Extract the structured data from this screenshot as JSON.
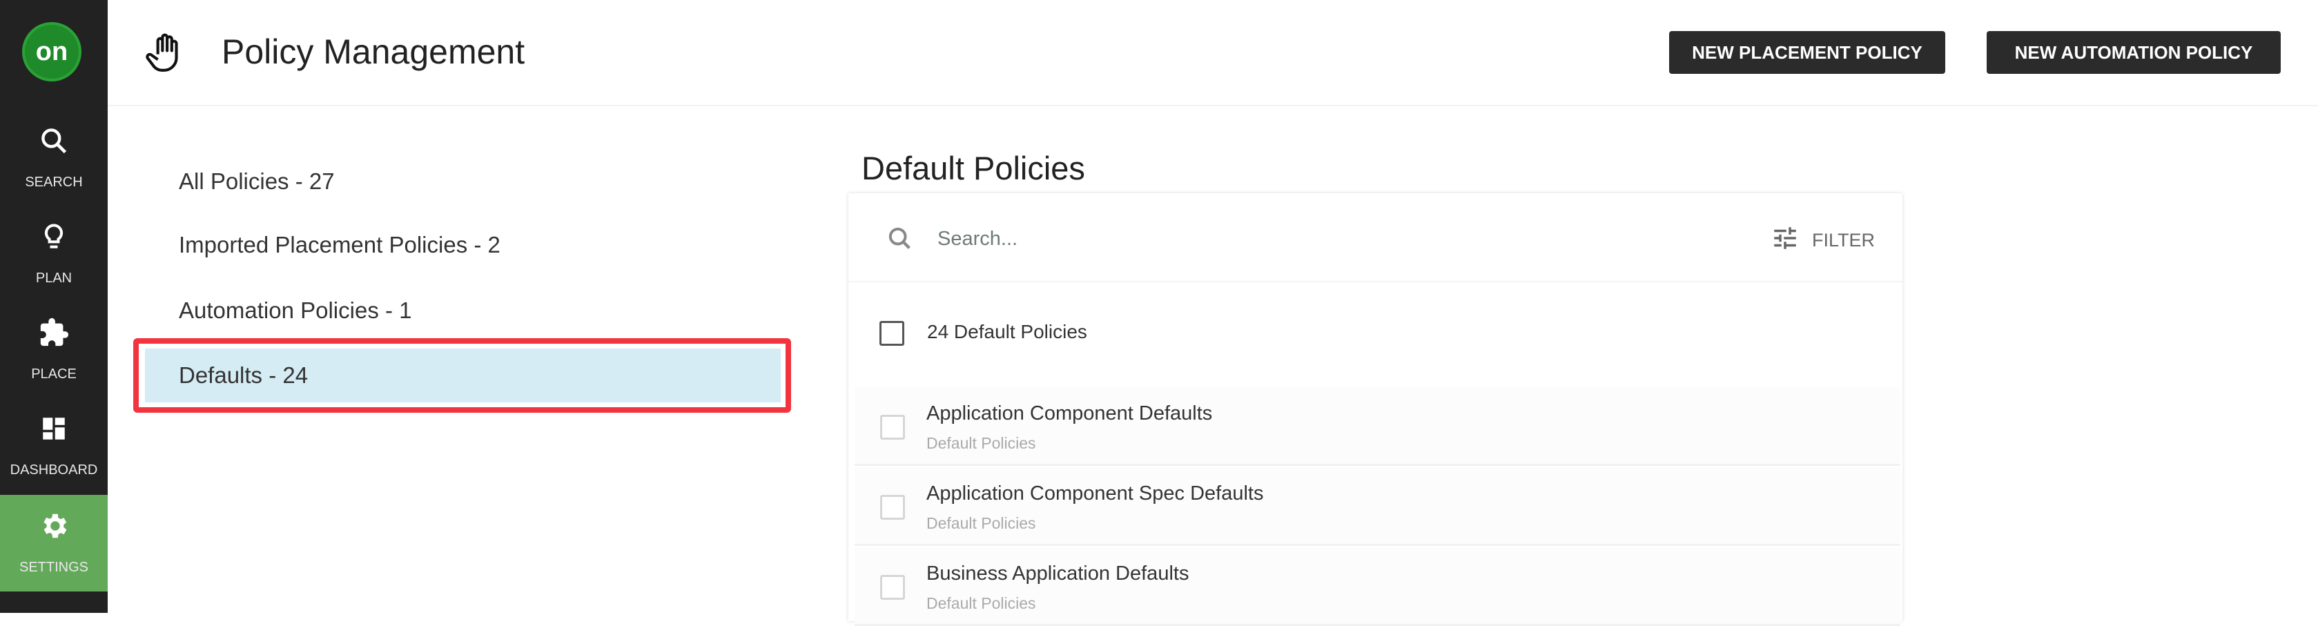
{
  "sidebar": {
    "logo": "on",
    "items": [
      {
        "label": "SEARCH",
        "icon": "search-icon"
      },
      {
        "label": "PLAN",
        "icon": "lightbulb-icon"
      },
      {
        "label": "PLACE",
        "icon": "puzzle-icon"
      },
      {
        "label": "DASHBOARD",
        "icon": "dashboard-icon"
      },
      {
        "label": "SETTINGS",
        "icon": "gear-icon",
        "active": true
      }
    ],
    "active_color": "#63a95a"
  },
  "header": {
    "title": "Policy Management",
    "icon": "hand-icon",
    "buttons": {
      "new_placement": "NEW PLACEMENT POLICY",
      "new_automation": "NEW AUTOMATION POLICY"
    }
  },
  "categories": [
    {
      "label": "All Policies - 27"
    },
    {
      "label": "Imported Placement Policies - 2"
    },
    {
      "label": "Automation Policies - 1"
    },
    {
      "label": "Defaults - 24",
      "selected": true
    }
  ],
  "main": {
    "heading": "Default Policies",
    "search_placeholder": "Search...",
    "filter_label": "FILTER",
    "select_all_label": "24 Default Policies",
    "rows": [
      {
        "title": "Application Component Defaults",
        "subtitle": "Default Policies"
      },
      {
        "title": "Application Component Spec Defaults",
        "subtitle": "Default Policies"
      },
      {
        "title": "Business Application Defaults",
        "subtitle": "Default Policies"
      }
    ]
  }
}
